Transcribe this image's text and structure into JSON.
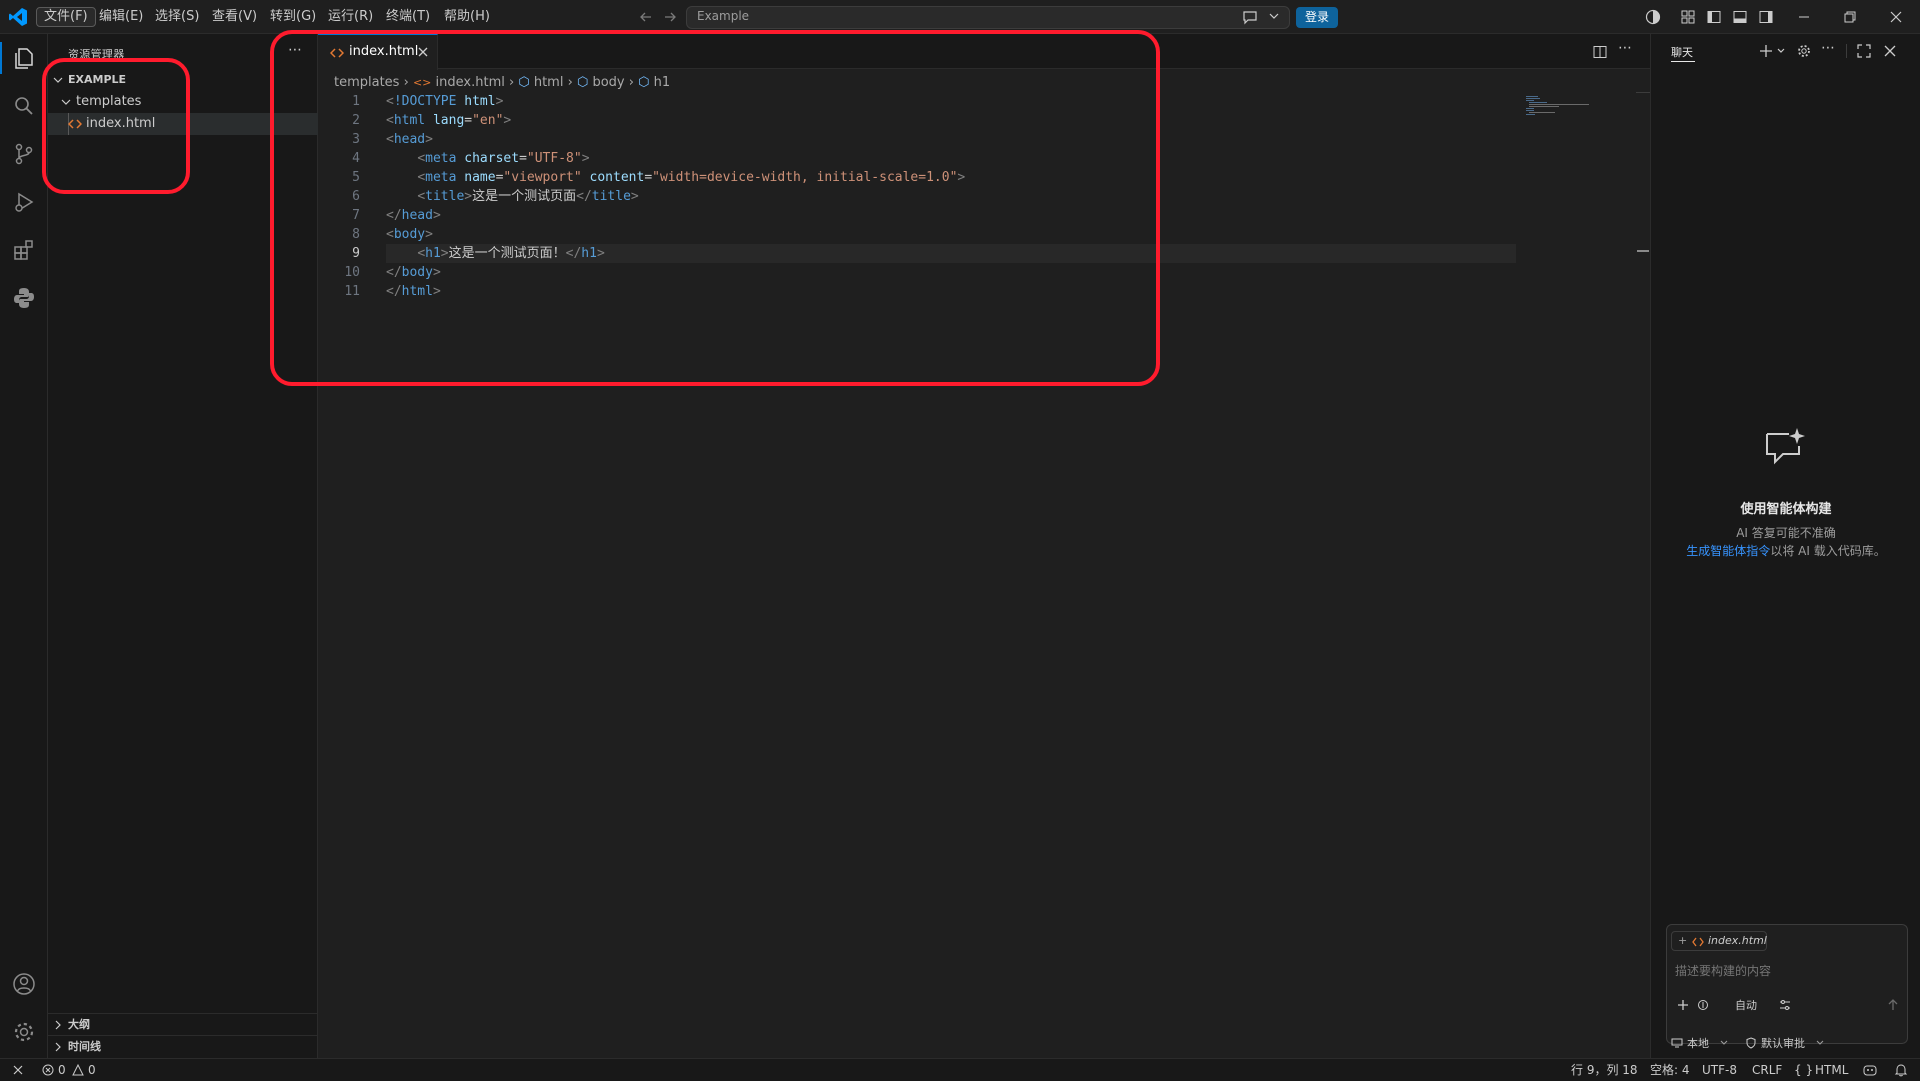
{
  "titlebar": {
    "menus": [
      "文件(F)",
      "编辑(E)",
      "选择(S)",
      "查看(V)",
      "转到(G)",
      "运行(R)",
      "终端(T)",
      "帮助(H)"
    ],
    "search_text": "Example",
    "login_label": "登录"
  },
  "sidebar": {
    "title": "资源管理器",
    "root": "EXAMPLE",
    "folder": "templates",
    "file": "index.html",
    "outline": "大纲",
    "timeline": "时间线"
  },
  "editor": {
    "tab_label": "index.html",
    "breadcrumb": [
      "templates",
      "index.html",
      "html",
      "body",
      "h1"
    ],
    "lines": [
      {
        "n": "1",
        "html": "<span class='p'>&lt;</span><span class='t'>!DOCTYPE</span> <span class='a'>html</span><span class='p'>&gt;</span>"
      },
      {
        "n": "2",
        "html": "<span class='p'>&lt;</span><span class='t'>html</span> <span class='a'>lang</span><span class='w'>=</span><span class='s'>\"en\"</span><span class='p'>&gt;</span>"
      },
      {
        "n": "3",
        "html": "<span class='p'>&lt;</span><span class='t'>head</span><span class='p'>&gt;</span>"
      },
      {
        "n": "4",
        "html": "    <span class='p'>&lt;</span><span class='t'>meta</span> <span class='a'>charset</span><span class='w'>=</span><span class='s'>\"UTF-8\"</span><span class='p'>&gt;</span>"
      },
      {
        "n": "5",
        "html": "    <span class='p'>&lt;</span><span class='t'>meta</span> <span class='a'>name</span><span class='w'>=</span><span class='s'>\"viewport\"</span> <span class='a'>content</span><span class='w'>=</span><span class='s'>\"width=device-width, initial-scale=1.0\"</span><span class='p'>&gt;</span>"
      },
      {
        "n": "6",
        "html": "    <span class='p'>&lt;</span><span class='t'>title</span><span class='p'>&gt;</span><span class='w'>这是一个测试页面</span><span class='p'>&lt;/</span><span class='t'>title</span><span class='p'>&gt;</span>"
      },
      {
        "n": "7",
        "html": "<span class='p'>&lt;/</span><span class='t'>head</span><span class='p'>&gt;</span>"
      },
      {
        "n": "8",
        "html": "<span class='p'>&lt;</span><span class='t'>body</span><span class='p'>&gt;</span>"
      },
      {
        "n": "9",
        "html": "    <span class='p'>&lt;</span><span class='t'>h1</span><span class='p'>&gt;</span><span class='w'>这是一个测试页面！</span><span class='p'>&lt;/</span><span class='t'>h1</span><span class='p'>&gt;</span>"
      },
      {
        "n": "10",
        "html": "<span class='p'>&lt;/</span><span class='t'>body</span><span class='p'>&gt;</span>"
      },
      {
        "n": "11",
        "html": "<span class='p'>&lt;/</span><span class='t'>html</span><span class='p'>&gt;</span>"
      }
    ],
    "current_line": "9"
  },
  "chat": {
    "title": "聊天",
    "heading": "使用智能体构建",
    "note": "AI 答复可能不准确",
    "link": "生成智能体指令",
    "link_suffix": "以将 AI 载入代码库。",
    "context_file": "index.html",
    "placeholder": "描述要构建的内容",
    "mode": "自动",
    "location": "本地",
    "approval": "默认审批"
  },
  "status": {
    "errors": "0",
    "warnings": "0",
    "position": "行 9，列 18",
    "spaces": "空格: 4",
    "encoding": "UTF-8",
    "eol": "CRLF",
    "language": "HTML"
  },
  "colors": {
    "accent": "#0078d4",
    "annotation": "#ff1b2d",
    "file_icon": "#e37933"
  }
}
